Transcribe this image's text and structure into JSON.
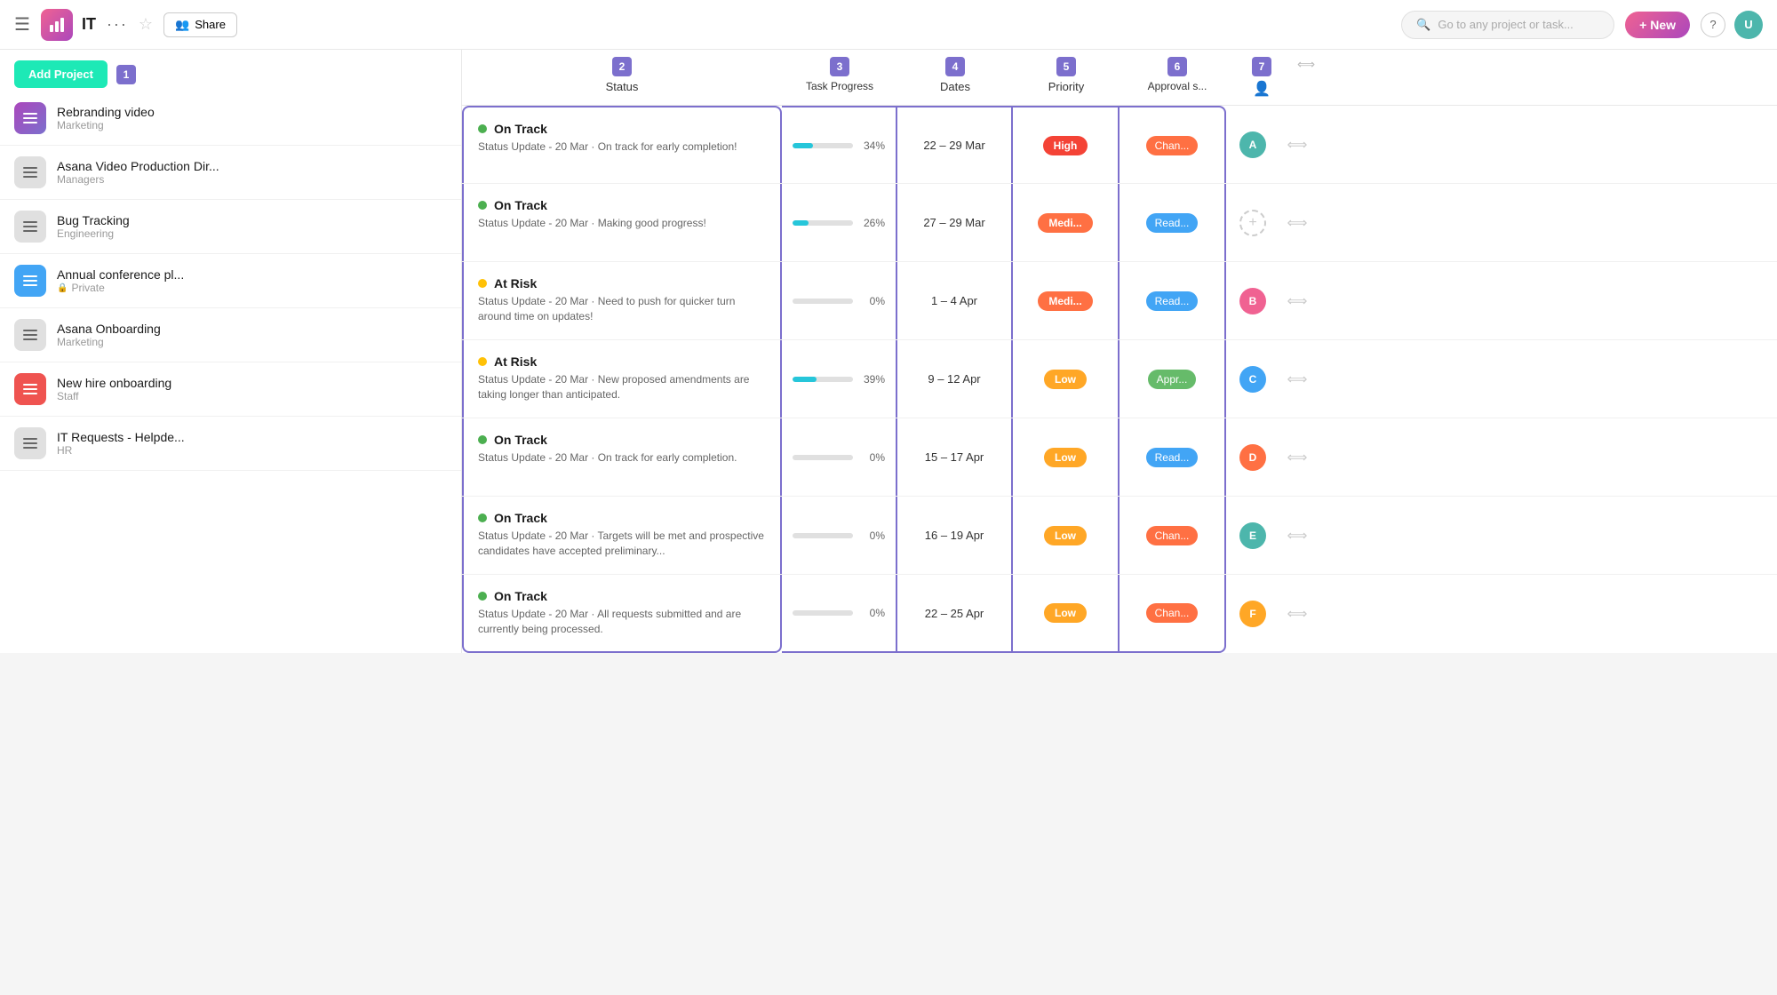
{
  "nav": {
    "title": "IT",
    "logo_letter": "📊",
    "dots": "···",
    "share_label": "Share",
    "search_placeholder": "Go to any project or task...",
    "new_label": "+ New",
    "help_label": "?",
    "avatar_initials": "U"
  },
  "sidebar": {
    "add_project_label": "Add Project",
    "badge_number": "1",
    "items": [
      {
        "id": "rebranding-video",
        "name": "Rebranding video",
        "sub": "Marketing",
        "icon_type": "purple",
        "private": false
      },
      {
        "id": "asana-video",
        "name": "Asana Video Production Dir...",
        "sub": "Managers",
        "icon_type": "gray",
        "private": false
      },
      {
        "id": "bug-tracking",
        "name": "Bug Tracking",
        "sub": "Engineering",
        "icon_type": "gray",
        "private": false
      },
      {
        "id": "annual-conference",
        "name": "Annual conference pl...",
        "sub": "Private",
        "icon_type": "blue",
        "private": true
      },
      {
        "id": "asana-onboarding",
        "name": "Asana Onboarding",
        "sub": "Marketing",
        "icon_type": "gray",
        "private": false
      },
      {
        "id": "new-hire",
        "name": "New hire onboarding",
        "sub": "Staff",
        "icon_type": "red",
        "private": false
      },
      {
        "id": "it-requests",
        "name": "IT Requests - Helpde...",
        "sub": "HR",
        "icon_type": "gray",
        "private": false
      }
    ]
  },
  "table": {
    "col_badges": [
      "2",
      "3",
      "4",
      "5",
      "6",
      "7"
    ],
    "col_labels": [
      "Status",
      "Task Progress",
      "Dates",
      "Priority",
      "Approval s...",
      ""
    ],
    "rows": [
      {
        "status_type": "green",
        "status_name": "On Track",
        "status_update": "Status Update - 20 Mar · On track for early completion!",
        "progress_pct": 34,
        "progress_label": "34%",
        "dates": "22 – 29 Mar",
        "priority": "High",
        "priority_type": "high",
        "approval": "Chan...",
        "approval_type": "changes",
        "avatar_type": "teal",
        "avatar_initials": "A"
      },
      {
        "status_type": "green",
        "status_name": "On Track",
        "status_update": "Status Update - 20 Mar · Making good progress!",
        "progress_pct": 26,
        "progress_label": "26%",
        "dates": "27 – 29 Mar",
        "priority": "Medi...",
        "priority_type": "medium",
        "approval": "Read...",
        "approval_type": "review",
        "avatar_type": "ghost",
        "avatar_initials": ""
      },
      {
        "status_type": "yellow",
        "status_name": "At Risk",
        "status_update": "Status Update - 20 Mar · Need to push for quicker turn around time on updates!",
        "progress_pct": 0,
        "progress_label": "0%",
        "dates": "1 – 4 Apr",
        "priority": "Medi...",
        "priority_type": "medium",
        "approval": "Read...",
        "approval_type": "review",
        "avatar_type": "pink",
        "avatar_initials": "B"
      },
      {
        "status_type": "yellow",
        "status_name": "At Risk",
        "status_update": "Status Update - 20 Mar · New proposed amendments are taking longer than anticipated.",
        "progress_pct": 39,
        "progress_label": "39%",
        "dates": "9 – 12 Apr",
        "priority": "Low",
        "priority_type": "low",
        "approval": "Appr...",
        "approval_type": "approved",
        "avatar_type": "blue",
        "avatar_initials": "C"
      },
      {
        "status_type": "green",
        "status_name": "On Track",
        "status_update": "Status Update - 20 Mar · On track for early completion.",
        "progress_pct": 0,
        "progress_label": "0%",
        "dates": "15 – 17 Apr",
        "priority": "Low",
        "priority_type": "low",
        "approval": "Read...",
        "approval_type": "review",
        "avatar_type": "orange",
        "avatar_initials": "D"
      },
      {
        "status_type": "green",
        "status_name": "On Track",
        "status_update": "Status Update - 20 Mar · Targets will be met and prospective candidates have accepted preliminary...",
        "progress_pct": 0,
        "progress_label": "0%",
        "dates": "16 – 19 Apr",
        "priority": "Low",
        "priority_type": "low",
        "approval": "Chan...",
        "approval_type": "changes",
        "avatar_type": "teal",
        "avatar_initials": "E"
      },
      {
        "status_type": "green",
        "status_name": "On Track",
        "status_update": "Status Update - 20 Mar · All requests submitted and are currently being processed.",
        "progress_pct": 0,
        "progress_label": "0%",
        "dates": "22 – 25 Apr",
        "priority": "Low",
        "priority_type": "low",
        "approval": "Chan...",
        "approval_type": "changes",
        "avatar_type": "amber",
        "avatar_initials": "F"
      }
    ]
  }
}
